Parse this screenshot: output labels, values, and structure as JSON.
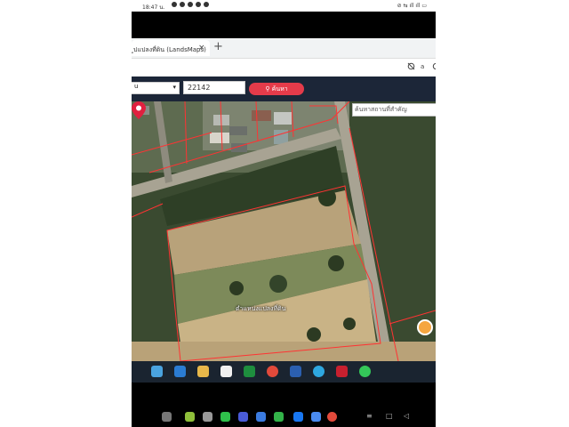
{
  "status_bar": {
    "time": "18:47 น.",
    "right_indicators": "⊘ ⇆ ıll ıll ▭"
  },
  "browser": {
    "tab_title": "ระบบค้นหาแปลงที่ดิน (LandsMaps)",
    "tab_title_visible": "ูปแปลงที่ดิน (LandsMaps)",
    "close_symbol": "×",
    "new_tab_symbol": "+"
  },
  "toolbar": {
    "icons": [
      "eye-slash-icon",
      "translate-icon",
      "settings-icon"
    ]
  },
  "site_header": {
    "province_value": "u",
    "parcel_number": "22142",
    "search_label": "ค้นหา",
    "search_icon": "magnifier-icon"
  },
  "map": {
    "place_search_placeholder": "ค้นหาสถานที่สำคัญ",
    "pin_label": "ตำแหน่งแปลงที่ดิน",
    "pin_color": "#e0203f",
    "boundary_color": "#ff3333",
    "layer_button_color": "#f5a640"
  },
  "taskbar": {
    "apps": [
      "start-icon",
      "file-explorer-icon",
      "store-icon",
      "calendar-icon",
      "excel-icon",
      "chrome-icon",
      "app-icon",
      "edge-icon",
      "mcafee-icon",
      "line-icon"
    ]
  },
  "navbar": {
    "apps": [
      "grid-icon",
      "app1-icon",
      "camera-icon",
      "line-icon",
      "files-icon",
      "chat-icon",
      "facebook-icon",
      "drive-icon",
      "chrome-icon"
    ],
    "nav_symbols": [
      "≡",
      "□",
      "◁"
    ]
  }
}
